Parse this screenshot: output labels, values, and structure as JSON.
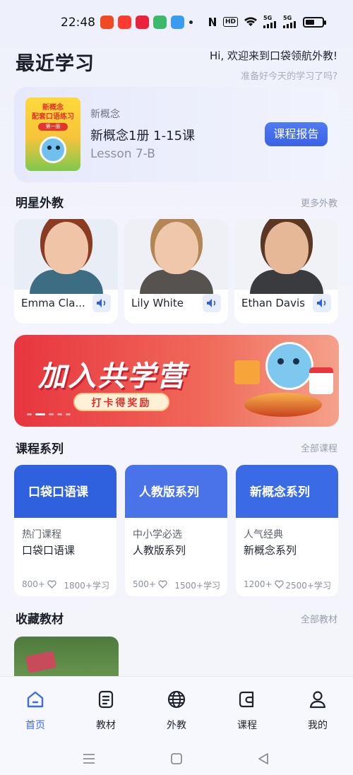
{
  "status_bar": {
    "time": "22:48",
    "hd_label": "HD",
    "signal_1": "5G",
    "signal_2": "5G",
    "battery_level": 0.55
  },
  "header": {
    "title": "最近学习",
    "welcome": "Hi, 欢迎来到口袋领航外教!",
    "subtitle": "准备好今天的学习了吗?"
  },
  "recent": {
    "book_title_line1": "新概念",
    "book_title_line2": "配套口语练习",
    "book_badge": "第一册",
    "category": "新概念",
    "course": "新概念1册 1-15课",
    "lesson": "Lesson 7-B",
    "report_button": "课程报告"
  },
  "teachers_section": {
    "title": "明星外教",
    "more": "更多外教",
    "teachers": [
      {
        "name": "Emma Cla...",
        "hair": "#8a3b22",
        "skin": "#f0c4a6",
        "shirt": "#3d6d83",
        "bg": "#e9edf5"
      },
      {
        "name": "Lily White",
        "hair": "#b48654",
        "skin": "#efc8ab",
        "shirt": "#55524f",
        "bg": "#eef0f6"
      },
      {
        "name": "Ethan Davis",
        "hair": "#5a3823",
        "skin": "#e7b898",
        "shirt": "#3a3b3f",
        "bg": "#f1f2f6"
      }
    ]
  },
  "banner": {
    "title": "加入共学营",
    "button": "打卡得奖励"
  },
  "series_section": {
    "title": "课程系列",
    "more": "全部课程",
    "items": [
      {
        "cover_title": "口袋口语课",
        "cover_bg": "#2f60dd",
        "tag": "热门课程",
        "name": "口袋口语课",
        "likes": "800+",
        "learners": "1800+学习"
      },
      {
        "cover_title": "人教版系列",
        "cover_bg": "#4a73ea",
        "tag": "中小学必选",
        "name": "人教版系列",
        "likes": "500+",
        "learners": "1500+学习"
      },
      {
        "cover_title": "新概念系列",
        "cover_bg": "#3a6ae6",
        "tag": "人气经典",
        "name": "新概念系列",
        "likes": "1200+",
        "learners": "2500+学习"
      }
    ]
  },
  "favorites_section": {
    "title": "收藏教材",
    "more": "全部教材"
  },
  "tab_bar": {
    "tabs": [
      {
        "label": "首页",
        "icon": "home-icon",
        "active": true
      },
      {
        "label": "教材",
        "icon": "textbook-icon",
        "active": false
      },
      {
        "label": "外教",
        "icon": "globe-icon",
        "active": false
      },
      {
        "label": "课程",
        "icon": "course-icon",
        "active": false
      },
      {
        "label": "我的",
        "icon": "profile-icon",
        "active": false
      }
    ]
  },
  "colors": {
    "accent": "#3d6be8",
    "banner_red": "#e8353f"
  }
}
